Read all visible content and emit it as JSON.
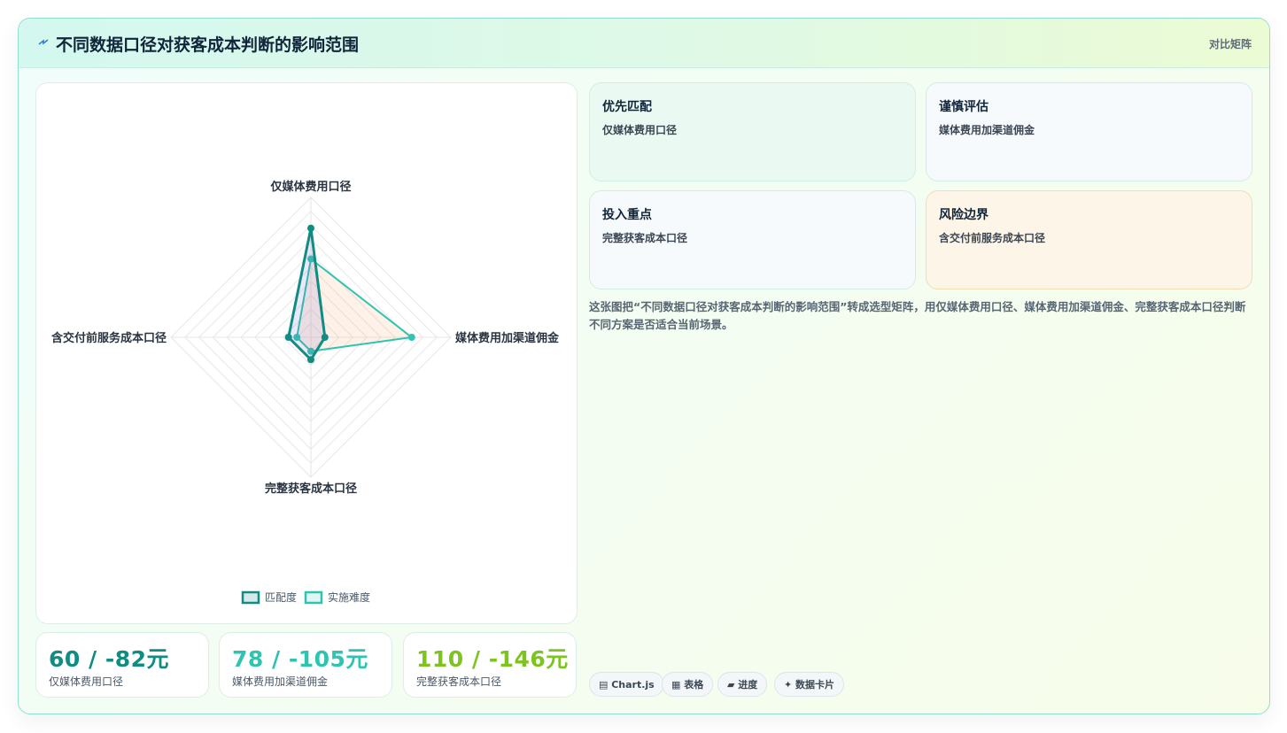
{
  "header": {
    "title": "不同数据口径对获客成本判断的影响范围",
    "right_label": "对比矩阵"
  },
  "chart_data": {
    "type": "radar",
    "axes": [
      "仅媒体费用口径",
      "媒体费用加渠道佣金",
      "完整获客成本口径",
      "含交付前服务成本口径"
    ],
    "max": 100,
    "rings": 10,
    "series": [
      {
        "name": "匹配度",
        "values": [
          78,
          10,
          16,
          16
        ],
        "color": "#118c82"
      },
      {
        "name": "实施难度",
        "values": [
          56,
          72,
          10,
          10
        ],
        "color": "#2ec4b0"
      }
    ],
    "legend_position": "bottom"
  },
  "stats": [
    {
      "value": "60 / -82元",
      "label": "仅媒体费用口径",
      "color": "#118c82"
    },
    {
      "value": "78 / -105元",
      "label": "媒体费用加渠道佣金",
      "color": "#2ec4b0"
    },
    {
      "value": "110 / -146元",
      "label": "完整获客成本口径",
      "color": "#7ec421"
    }
  ],
  "cards": [
    {
      "title": "优先匹配",
      "text": "仅媒体费用口径"
    },
    {
      "title": "谨慎评估",
      "text": "媒体费用加渠道佣金"
    },
    {
      "title": "投入重点",
      "text": "完整获客成本口径"
    },
    {
      "title": "风险边界",
      "text": "含交付前服务成本口径"
    }
  ],
  "description": "这张图把“不同数据口径对获客成本判断的影响范围”转成选型矩阵，用仅媒体费用口径、媒体费用加渠道佣金、完整获客成本口径判断不同方案是否适合当前场景。",
  "tags": [
    "▤ Chart.js",
    "▦ 表格",
    "▰ 进度",
    "✦ 数据卡片"
  ],
  "colors": {
    "accent": "#118c82",
    "accent2": "#2ec4b0",
    "lime": "#7ec421",
    "risk_card_bg": "#fdf5e7",
    "risk_card_border": "#f2ddb3",
    "card_green_bg": "#eafaf2",
    "card_neutral_bg": "#f7fafc"
  }
}
